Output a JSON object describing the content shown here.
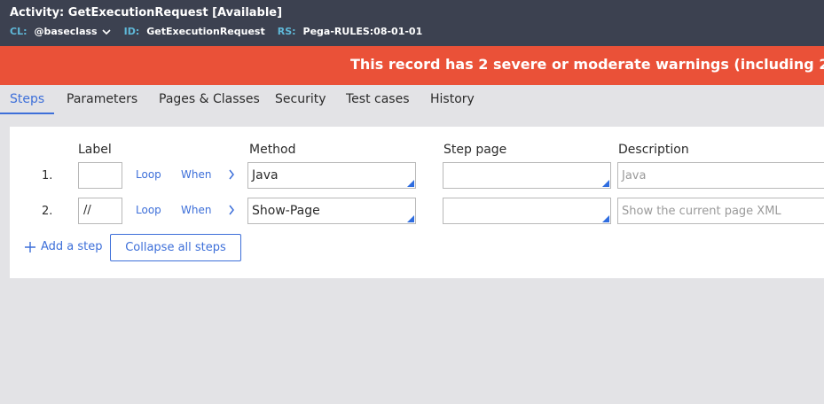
{
  "header": {
    "title": "Activity: GetExecutionRequest",
    "availability": "[Available]",
    "class_key": "CL:",
    "class_value": "@baseclass",
    "id_key": "ID:",
    "id_value": "GetExecutionRequest",
    "rs_key": "RS:",
    "rs_value": "Pega-RULES:08-01-01"
  },
  "warning": {
    "text": "This record has 2 severe or moderate warnings (including 2"
  },
  "tabs": [
    {
      "label": "Steps",
      "active": true
    },
    {
      "label": "Parameters"
    },
    {
      "label": "Pages & Classes"
    },
    {
      "label": "Security"
    },
    {
      "label": "Test cases"
    },
    {
      "label": "History"
    }
  ],
  "columns": {
    "label": "Label",
    "method": "Method",
    "step_page": "Step page",
    "description": "Description"
  },
  "steps": [
    {
      "number": "1.",
      "label": "",
      "loop": "Loop",
      "when": "When",
      "method": "Java",
      "step_page": "",
      "description": "Java"
    },
    {
      "number": "2.",
      "label": "//",
      "loop": "Loop",
      "when": "When",
      "method": "Show-Page",
      "step_page": "",
      "description": "Show the current page XML"
    }
  ],
  "actions": {
    "add_step": "Add a step",
    "collapse_all": "Collapse all steps"
  },
  "colors": {
    "header_bg": "#3c4150",
    "warning_bg": "#ea5138",
    "accent": "#3d6fd9"
  }
}
